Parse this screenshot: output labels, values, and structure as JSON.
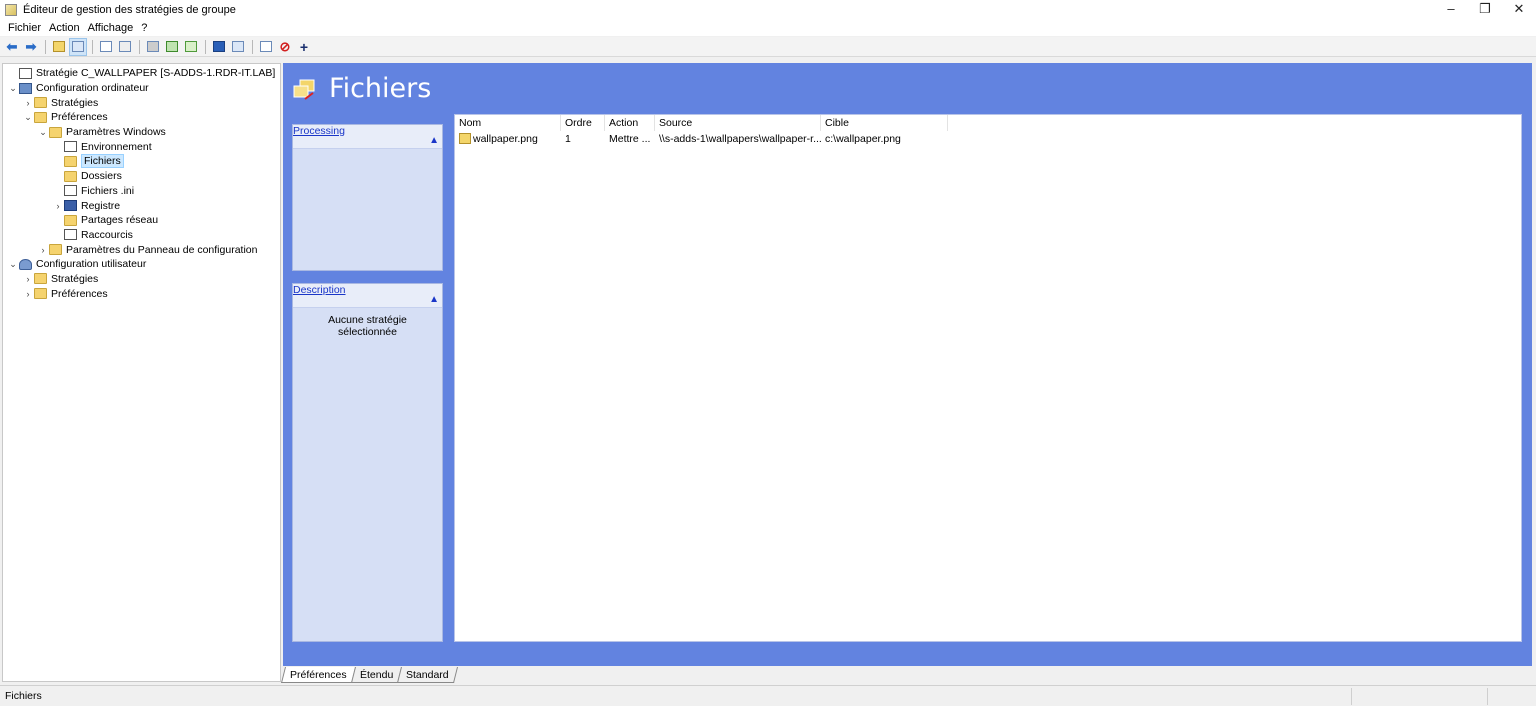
{
  "window": {
    "title": "Éditeur de gestion des stratégies de groupe",
    "min": "–",
    "max": "❐",
    "close": "✕"
  },
  "menu": [
    "Fichier",
    "Action",
    "Affichage",
    "?"
  ],
  "tree": [
    {
      "label": "Stratégie C_WALLPAPER [S-ADDS-1.RDR-IT.LAB]",
      "depth": 0,
      "twisty": "",
      "icon": "gpo-icon"
    },
    {
      "label": "Configuration ordinateur",
      "depth": 0,
      "twisty": "v",
      "icon": "computer-icon"
    },
    {
      "label": "Stratégies",
      "depth": 1,
      "twisty": ">",
      "icon": "folder-icon"
    },
    {
      "label": "Préférences",
      "depth": 1,
      "twisty": "v",
      "icon": "folder-icon"
    },
    {
      "label": "Paramètres Windows",
      "depth": 2,
      "twisty": "v",
      "icon": "folder-icon"
    },
    {
      "label": "Environnement",
      "depth": 3,
      "twisty": "",
      "icon": "environment-icon"
    },
    {
      "label": "Fichiers",
      "depth": 3,
      "twisty": "",
      "icon": "files-icon",
      "selected": true
    },
    {
      "label": "Dossiers",
      "depth": 3,
      "twisty": "",
      "icon": "folders-icon"
    },
    {
      "label": "Fichiers .ini",
      "depth": 3,
      "twisty": "",
      "icon": "ini-file-icon"
    },
    {
      "label": "Registre",
      "depth": 3,
      "twisty": ">",
      "icon": "registry-icon"
    },
    {
      "label": "Partages réseau",
      "depth": 3,
      "twisty": "",
      "icon": "network-share-icon"
    },
    {
      "label": "Raccourcis",
      "depth": 3,
      "twisty": "",
      "icon": "shortcut-icon"
    },
    {
      "label": "Paramètres du Panneau de configuration",
      "depth": 2,
      "twisty": ">",
      "icon": "folder-icon"
    },
    {
      "label": "Configuration utilisateur",
      "depth": 0,
      "twisty": "v",
      "icon": "user-icon"
    },
    {
      "label": "Stratégies",
      "depth": 1,
      "twisty": ">",
      "icon": "folder-icon"
    },
    {
      "label": "Préférences",
      "depth": 1,
      "twisty": ">",
      "icon": "folder-icon"
    }
  ],
  "main": {
    "title": "Fichiers",
    "processing_label": "Processing",
    "description_label": "Description",
    "description_text": "Aucune stratégie sélectionnée",
    "columns": [
      "Nom",
      "Ordre",
      "Action",
      "Source",
      "Cible"
    ],
    "rows": [
      {
        "nom": "wallpaper.png",
        "ordre": "1",
        "action": "Mettre ...",
        "source": "\\\\s-adds-1\\wallpapers\\wallpaper-r...",
        "cible": "c:\\wallpaper.png"
      }
    ]
  },
  "tabs": [
    "Préférences",
    "Étendu",
    "Standard"
  ],
  "status": {
    "text": "Fichiers"
  },
  "colors": {
    "panel_bg": "#6283e0",
    "sidebox_bg": "#d6dff5",
    "link": "#1a36c8"
  }
}
